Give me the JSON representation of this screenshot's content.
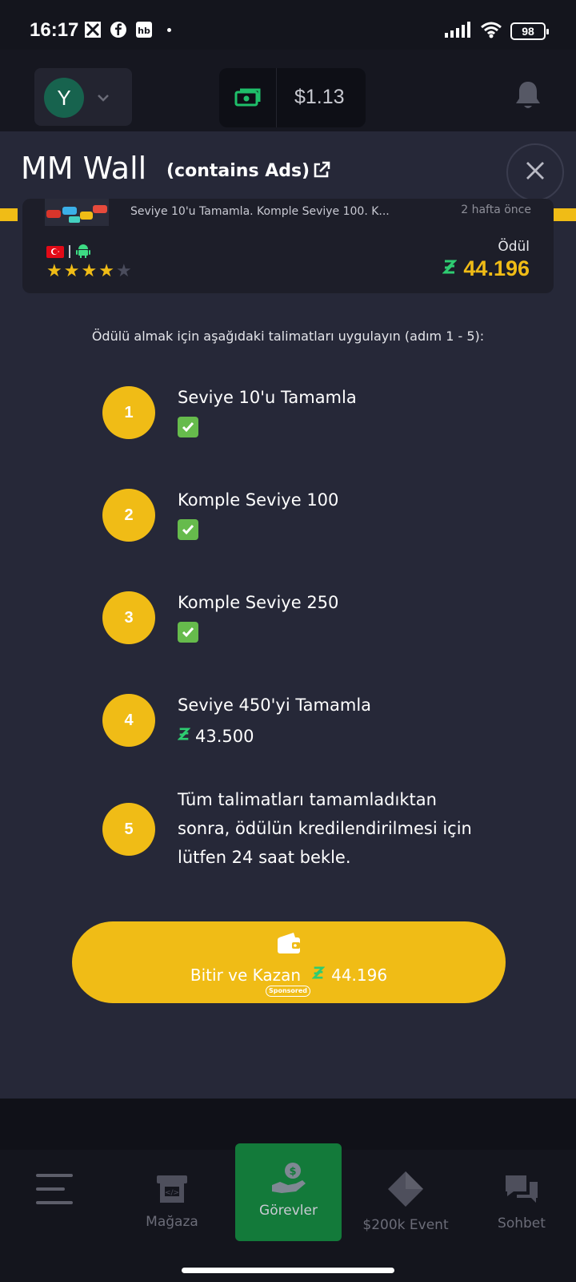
{
  "status_bar": {
    "time": "16:17",
    "battery": "98",
    "icons": [
      "kite-icon",
      "facebook-icon",
      "hb-icon",
      "dot-icon",
      "signal-icon",
      "wifi-icon",
      "battery-icon"
    ],
    "hb_label": "hb"
  },
  "header": {
    "avatar_letter": "Y",
    "balance": "$1.13"
  },
  "sheet": {
    "title": "MM Wall",
    "subtitle": "(contains Ads)"
  },
  "offer": {
    "description": "Seviye 10'u Tamamla. Komple Seviye 100. K...",
    "time_ago": "2 hafta önce",
    "reward_label": "Ödül",
    "reward_value": "44.196",
    "rating": 4,
    "rating_max": 5,
    "platforms": [
      "turkey-flag-icon",
      "android-icon"
    ]
  },
  "instructions": "Ödülü almak için aşağıdaki talimatları uygulayın (adım 1 - 5):",
  "steps": [
    {
      "number": "1",
      "text": "Seviye 10'u Tamamla",
      "status": "completed"
    },
    {
      "number": "2",
      "text": "Komple Seviye 100",
      "status": "completed"
    },
    {
      "number": "3",
      "text": "Komple Seviye 250",
      "status": "completed"
    },
    {
      "number": "4",
      "text": "Seviye 450'yi Tamamla",
      "reward": "43.500"
    },
    {
      "number": "5",
      "text": "Tüm talimatları tamamladıktan sonra, ödülün kredilendirilmesi için lütfen 24 saat bekle."
    }
  ],
  "cta": {
    "label": "Bitir ve Kazan",
    "value": "44.196",
    "badge": "Sponsored"
  },
  "nav": {
    "items": [
      {
        "label": "",
        "icon": "menu-icon"
      },
      {
        "label": "Mağaza",
        "icon": "store-icon"
      },
      {
        "label": "Görevler",
        "icon": "earn-icon",
        "active": true
      },
      {
        "label": "$200k Event",
        "icon": "diamond-icon"
      },
      {
        "label": "Sohbet",
        "icon": "chat-icon"
      }
    ]
  },
  "colors": {
    "accent": "#f0bc16",
    "coin_green": "#2ecc71",
    "background": "#262838",
    "nav_active": "#137a3a"
  }
}
